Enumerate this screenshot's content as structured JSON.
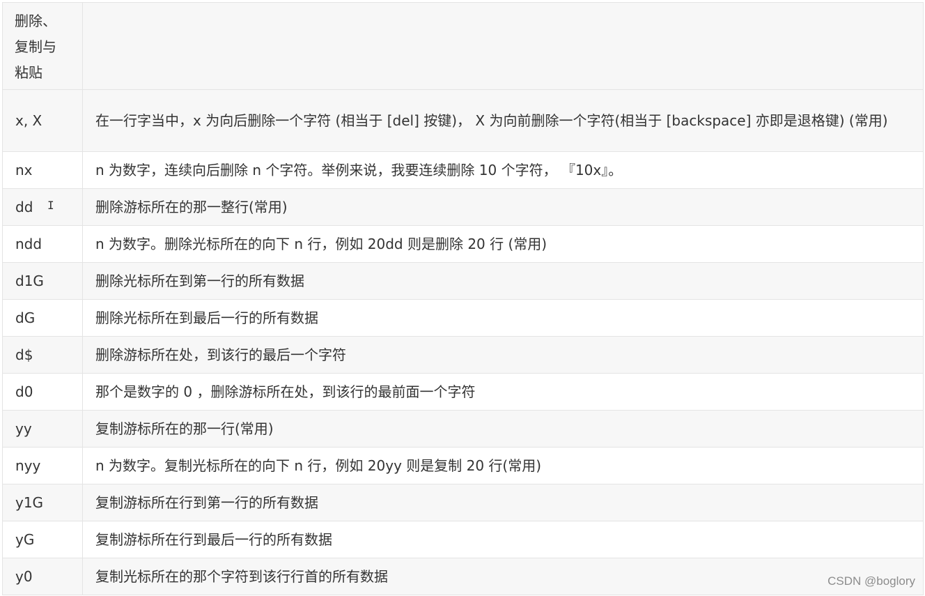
{
  "header": {
    "category": [
      "删除、",
      "复制与",
      "粘贴"
    ],
    "description": ""
  },
  "rows": [
    {
      "cmd": "x, X",
      "desc": "在一行字当中，x 为向后删除一个字符 (相当于 [del] 按键)， X 为向前删除一个字符(相当于 [backspace] 亦即是退格键) (常用)"
    },
    {
      "cmd": "nx",
      "desc": "n 为数字，连续向后删除 n 个字符。举例来说，我要连续删除 10 个字符， 『10x』。"
    },
    {
      "cmd": "dd",
      "desc": "删除游标所在的那一整行(常用)"
    },
    {
      "cmd": "ndd",
      "desc": "n 为数字。删除光标所在的向下 n 行，例如 20dd 则是删除 20 行 (常用)"
    },
    {
      "cmd": "d1G",
      "desc": "删除光标所在到第一行的所有数据"
    },
    {
      "cmd": "dG",
      "desc": "删除光标所在到最后一行的所有数据"
    },
    {
      "cmd": "d$",
      "desc": "删除游标所在处，到该行的最后一个字符"
    },
    {
      "cmd": "d0",
      "desc": "那个是数字的 0 ，删除游标所在处，到该行的最前面一个字符"
    },
    {
      "cmd": "yy",
      "desc": "复制游标所在的那一行(常用)"
    },
    {
      "cmd": "nyy",
      "desc": "n 为数字。复制光标所在的向下 n 行，例如 20yy 则是复制 20 行(常用)"
    },
    {
      "cmd": "y1G",
      "desc": "复制游标所在行到第一行的所有数据"
    },
    {
      "cmd": "yG",
      "desc": "复制游标所在行到最后一行的所有数据"
    },
    {
      "cmd": "y0",
      "desc": "复制光标所在的那个字符到该行行首的所有数据"
    }
  ],
  "cursor_glyph": "I",
  "watermark": "CSDN @boglory"
}
